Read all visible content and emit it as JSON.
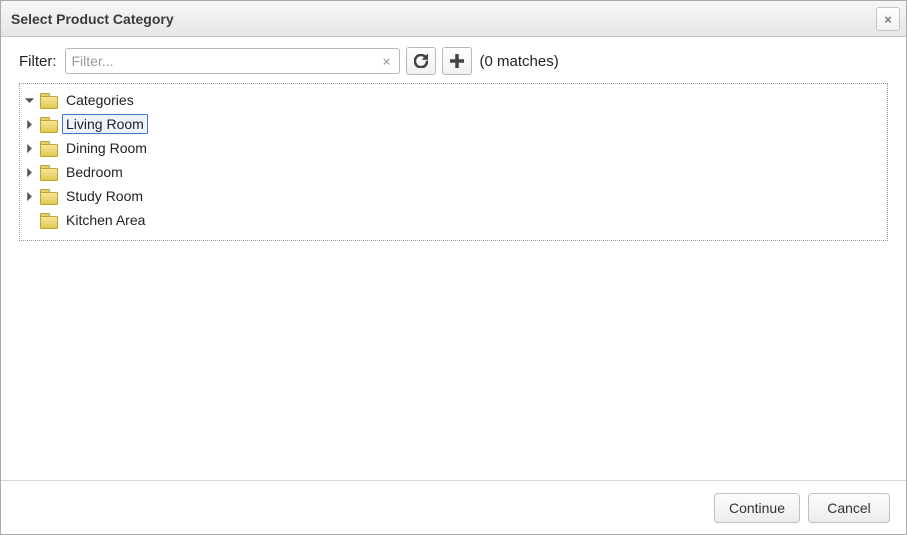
{
  "dialog": {
    "title": "Select Product Category"
  },
  "filter": {
    "label": "Filter:",
    "placeholder": "Filter...",
    "matches_text": "(0 matches)"
  },
  "tree": {
    "root": {
      "label": "Categories",
      "expanded": true
    },
    "children": [
      {
        "label": "Living Room",
        "has_children": true,
        "selected": true
      },
      {
        "label": "Dining Room",
        "has_children": true,
        "selected": false
      },
      {
        "label": "Bedroom",
        "has_children": true,
        "selected": false
      },
      {
        "label": "Study Room",
        "has_children": true,
        "selected": false
      },
      {
        "label": "Kitchen Area",
        "has_children": false,
        "selected": false
      }
    ]
  },
  "buttons": {
    "continue": "Continue",
    "cancel": "Cancel"
  },
  "icons": {
    "close": "×",
    "clear": "×"
  }
}
